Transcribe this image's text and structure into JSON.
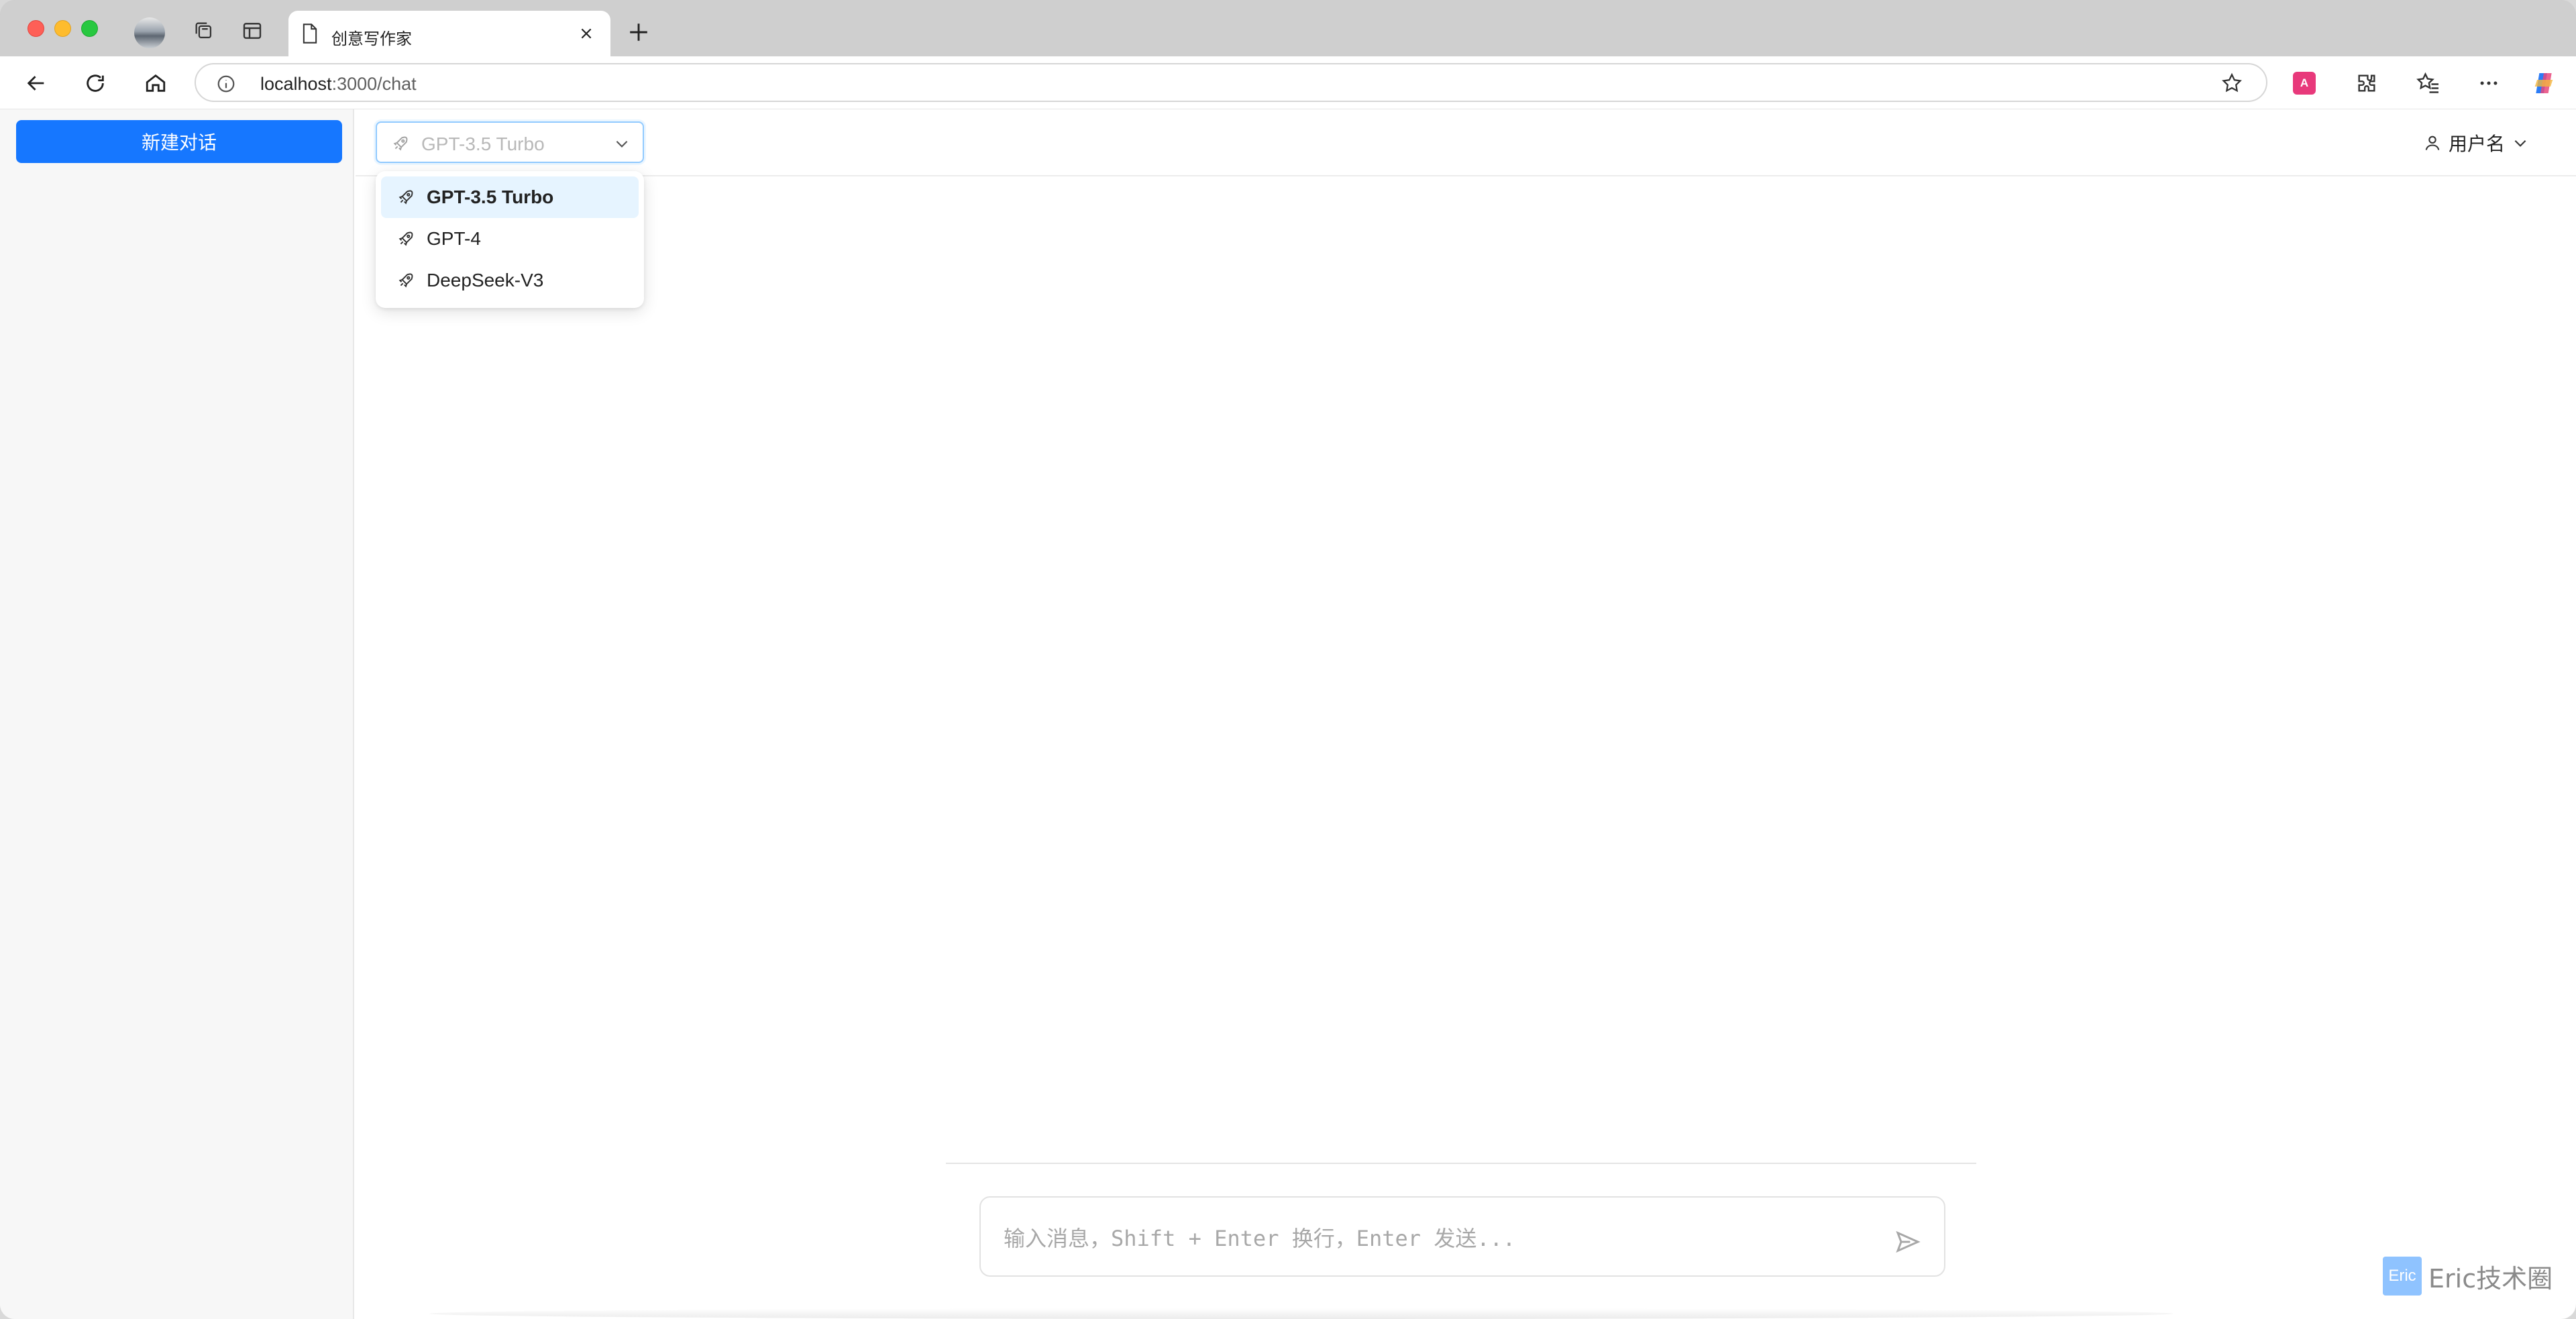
{
  "browser": {
    "tab_title": "创意写作家",
    "url_host": "localhost",
    "url_path": ":3000/chat",
    "translate_ext_label": "A"
  },
  "sidebar": {
    "new_chat_label": "新建对话"
  },
  "header": {
    "model_select_value": "GPT-3.5 Turbo",
    "user_name": "用户名"
  },
  "model_dropdown": {
    "options": [
      {
        "label": "GPT-3.5 Turbo",
        "selected": true
      },
      {
        "label": "GPT-4",
        "selected": false
      },
      {
        "label": "DeepSeek-V3",
        "selected": false
      }
    ]
  },
  "composer": {
    "placeholder": "输入消息，Shift + Enter 换行，Enter 发送..."
  },
  "watermark": {
    "badge": "Eric",
    "text": "Eric技术圈"
  },
  "colors": {
    "accent": "#1677ff",
    "selected_option_bg": "#e6f4ff"
  }
}
